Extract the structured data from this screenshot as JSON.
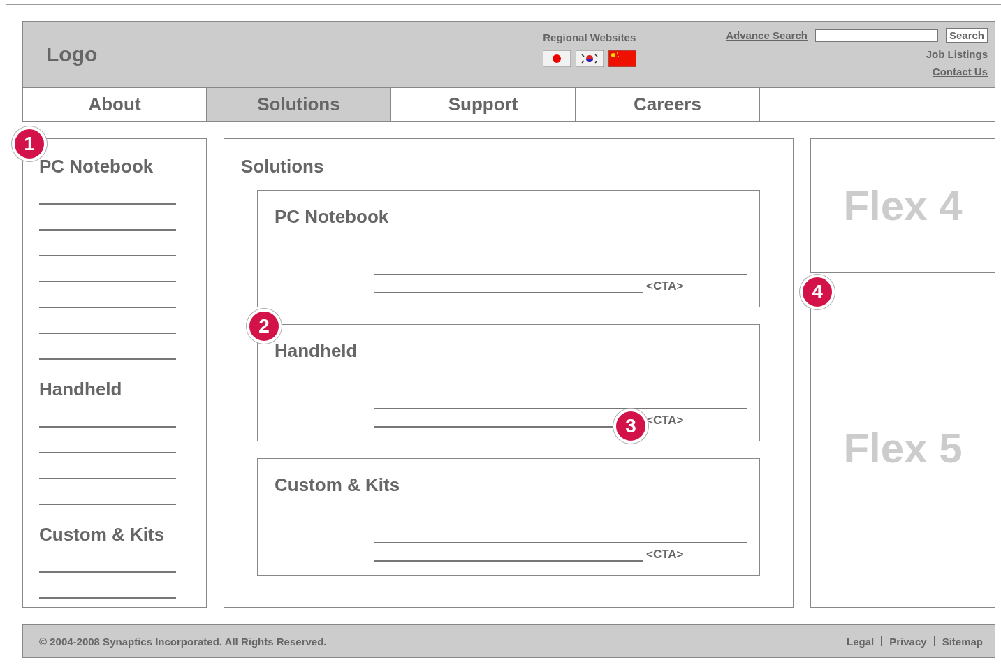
{
  "header": {
    "logo": "Logo",
    "regional_label": "Regional Websites",
    "flags": [
      {
        "kind": "japan"
      },
      {
        "kind": "korea"
      },
      {
        "kind": "china"
      }
    ],
    "advance_search": "Advance Search",
    "search_button": "Search",
    "links": [
      "Job Listings",
      "Contact Us"
    ]
  },
  "nav": [
    {
      "label": "About",
      "selected": false
    },
    {
      "label": "Solutions",
      "selected": true
    },
    {
      "label": "Support",
      "selected": false
    },
    {
      "label": "Careers",
      "selected": false
    }
  ],
  "sidebar": {
    "sections": [
      {
        "title": "PC Notebook"
      },
      {
        "title": "Handheld"
      },
      {
        "title": "Custom & Kits"
      }
    ]
  },
  "main": {
    "title": "Solutions",
    "cards": [
      {
        "title": "PC Notebook",
        "cta": "<CTA>"
      },
      {
        "title": "Handheld",
        "cta": "<CTA>"
      },
      {
        "title": "Custom & Kits",
        "cta": "<CTA>"
      }
    ]
  },
  "flex_panels": [
    {
      "label": "Flex 4"
    },
    {
      "label": "Flex 5"
    }
  ],
  "callouts": [
    "1",
    "2",
    "3",
    "4"
  ],
  "footer": {
    "copyright": "© 2004-2008 Synaptics Incorporated. All Rights Reserved.",
    "links": [
      "Legal",
      "Privacy",
      "Sitemap"
    ]
  }
}
